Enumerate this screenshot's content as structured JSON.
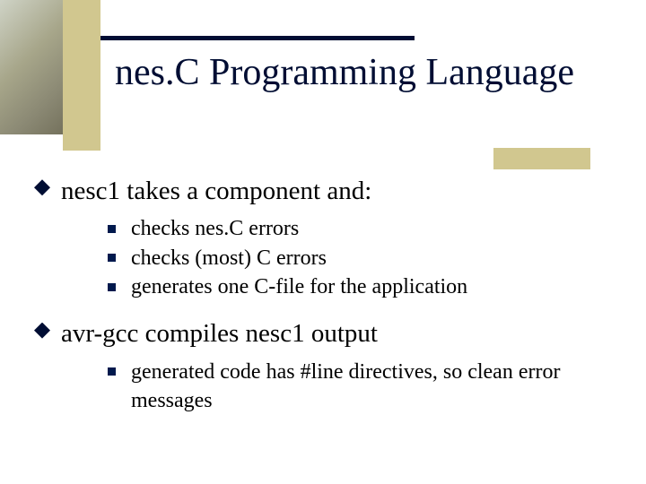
{
  "title": "nes.C Programming Language",
  "bullets": [
    {
      "text": "nesc1 takes a component and:",
      "sub": [
        "checks nes.C errors",
        "checks (most) C errors",
        "generates one C-file for the application"
      ]
    },
    {
      "text": "avr-gcc  compiles nesc1 output",
      "sub": [
        "generated code has #line directives, so clean error messages"
      ]
    }
  ]
}
